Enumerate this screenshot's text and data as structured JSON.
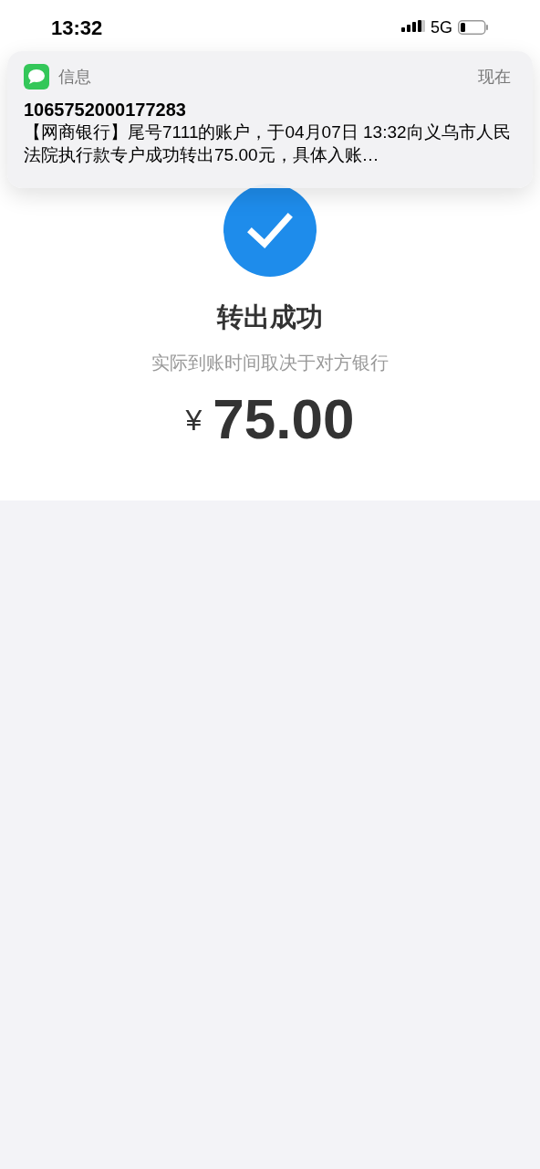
{
  "status_bar": {
    "time": "13:32",
    "network": "5G"
  },
  "notification": {
    "app": "信息",
    "time": "现在",
    "sender": "1065752000177283",
    "body": "【网商银行】尾号7111的账户，于04月07日 13:32向义乌市人民法院执行款专户成功转出75.00元，具体入账…"
  },
  "result": {
    "title": "转出成功",
    "subtitle": "实际到账时间取决于对方银行",
    "currency": "¥",
    "amount": "75.00"
  }
}
